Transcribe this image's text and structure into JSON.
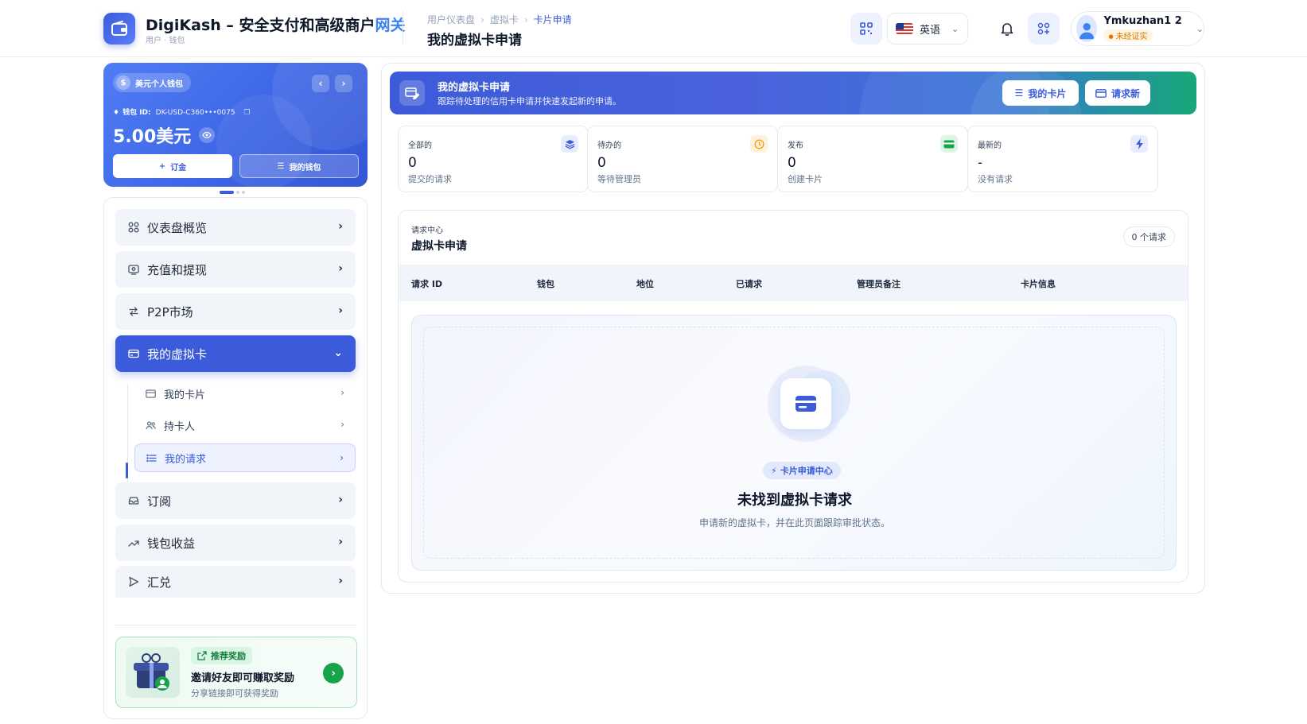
{
  "header": {
    "brand_main": "DigiKash – 安全支付和高级商户",
    "brand_accent": "网关",
    "brand_sub": "用户 · 钱包",
    "breadcrumb": [
      "用户仪表盘",
      "虚拟卡",
      "卡片申请"
    ],
    "page_title": "我的虚拟卡申请",
    "language": "英语",
    "user_name": "Ymkuzhan1 2",
    "user_status": "未经证实"
  },
  "wallet": {
    "pill_label": "美元个人钱包",
    "currency_symbol": "$",
    "id_label": "钱包 ID:",
    "id_value": "DK-USD-C360•••0075",
    "balance": "5.00美元",
    "deposit_label": "订金",
    "my_wallet_label": "我的钱包"
  },
  "sidebar": {
    "items": [
      {
        "label": "仪表盘概览"
      },
      {
        "label": "充值和提现"
      },
      {
        "label": "P2P市场"
      },
      {
        "label": "我的虚拟卡"
      },
      {
        "label": "订阅"
      },
      {
        "label": "钱包收益"
      },
      {
        "label": "汇兑"
      }
    ],
    "subitems": [
      {
        "label": "我的卡片"
      },
      {
        "label": "持卡人"
      },
      {
        "label": "我的请求"
      }
    ],
    "referral": {
      "tag": "推荐奖励",
      "title": "邀请好友即可赚取奖励",
      "subtitle": "分享链接即可获得奖励"
    }
  },
  "banner": {
    "title": "我的虚拟卡申请",
    "subtitle": "跟踪待处理的信用卡申请并快速发起新的申请。",
    "btn_my_cards": "我的卡片",
    "btn_request_new": "请求新"
  },
  "stats": [
    {
      "label": "全部的",
      "value": "0",
      "sub": "提交的请求",
      "icon": "layers-icon",
      "color": "#3b5bdb"
    },
    {
      "label": "待办的",
      "value": "0",
      "sub": "等待管理员",
      "icon": "clock-icon",
      "color": "#f59e0b"
    },
    {
      "label": "发布",
      "value": "0",
      "sub": "创建卡片",
      "icon": "card-icon",
      "color": "#16a34a"
    },
    {
      "label": "最新的",
      "value": "-",
      "sub": "没有请求",
      "icon": "bolt-icon",
      "color": "#3b5bdb"
    }
  ],
  "table": {
    "kicker": "请求中心",
    "title": "虚拟卡申请",
    "count": "0 个请求",
    "columns": [
      "请求 ID",
      "钱包",
      "地位",
      "已请求",
      "管理员备注",
      "卡片信息"
    ]
  },
  "empty_state": {
    "chip": "卡片申请中心",
    "title": "未找到虚拟卡请求",
    "description": "申请新的虚拟卡，并在此页面跟踪审批状态。"
  }
}
